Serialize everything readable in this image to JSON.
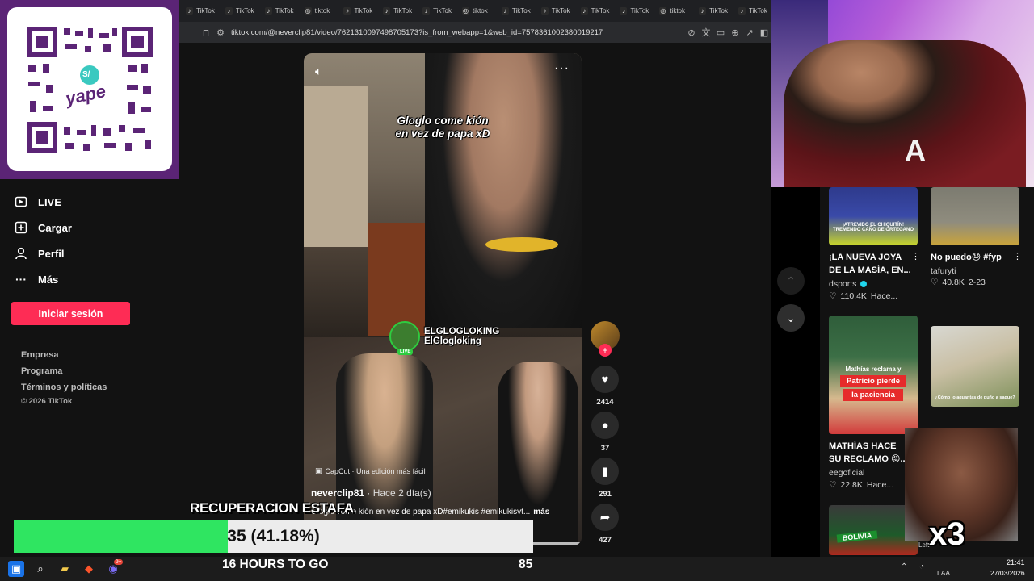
{
  "browser": {
    "tabs": [
      "TikTok",
      "TikTok",
      "TikTok",
      "tiktok",
      "TikTok",
      "TikTok",
      "TikTok",
      "tiktok",
      "TikTok",
      "TikTok",
      "TikTok",
      "TikTok",
      "tiktok",
      "TikTok",
      "TikTok"
    ],
    "url": "tiktok.com/@neverclip81/video/7621310097498705173?is_from_webapp=1&web_id=7578361002380019217"
  },
  "qr": {
    "brand": "yape",
    "badge": "S/"
  },
  "sidebar": {
    "items": [
      {
        "label": "LIVE",
        "icon": "live-icon"
      },
      {
        "label": "Cargar",
        "icon": "upload-icon"
      },
      {
        "label": "Perfil",
        "icon": "profile-icon"
      },
      {
        "label": "Más",
        "icon": "more-icon"
      }
    ],
    "login_button": "Iniciar sesión",
    "footer": [
      "Empresa",
      "Programa",
      "Términos y políticas"
    ],
    "copyright": "© 2026 TikTok"
  },
  "video": {
    "caption_line1": "Gloglo come kión",
    "caption_line2": "en vez de papa xD",
    "streamer_handle": "ELGLOGLOKING",
    "streamer_name": "ElGlogloking",
    "live_badge": "LIVE",
    "capcut": "CapCut · Una edición más fácil",
    "author": "neverclip81",
    "time": "· Hace 2 día(s)",
    "description": "Gloglo come kión en vez de papa xD#emikukis #emikukisvt...",
    "more": "más"
  },
  "actions": {
    "likes": "2414",
    "comments": "37",
    "saves": "291",
    "shares": "427"
  },
  "recommended": [
    {
      "title_line1": "¡LA NUEVA JOYA",
      "title_line2": "DE LA MASÍA, EN...",
      "user": "dsports",
      "likes": "110.4K",
      "date": "Hace..."
    },
    {
      "title_line1": "No puedo😓 #fyp",
      "title_line2": "",
      "user": "tafuryti",
      "likes": "40.8K",
      "date": "2-23"
    },
    {
      "title_line1": "MATHÍAS HACE",
      "title_line2": "SU RECLAMO 😡...",
      "user": "eegoficial",
      "likes": "22.8K",
      "date": "Hace..."
    }
  ],
  "thumb_text": {
    "t1": "¡ATREVIDO EL CHIQUITÍN! TREMENDO CAÑO DE ORTEGANO",
    "t3_line1": "Mathías reclama y",
    "t3_line2": "Patricio pierde",
    "t3_line3": "la paciencia",
    "t4": "¿Cómo lo aguantas de puño a saque?",
    "t5": "BOLIVIA"
  },
  "webcam": {
    "jersey_letter": "A"
  },
  "overlay": {
    "x3": "x3",
    "left_label": "Left"
  },
  "goal": {
    "title": "RECUPERACION ESTAFA",
    "value_text": "35 (41.18%)",
    "progress": 41.18,
    "hours_to_go": "16 HOURS TO GO",
    "target": "85"
  },
  "taskbar": {
    "badge": "9+",
    "lang": "LAA",
    "time": "21:41",
    "date": "27/03/2026"
  },
  "colors": {
    "tiktok_red": "#fe2c55",
    "goal_green": "#2fe561",
    "yape_purple": "#5b2476"
  }
}
